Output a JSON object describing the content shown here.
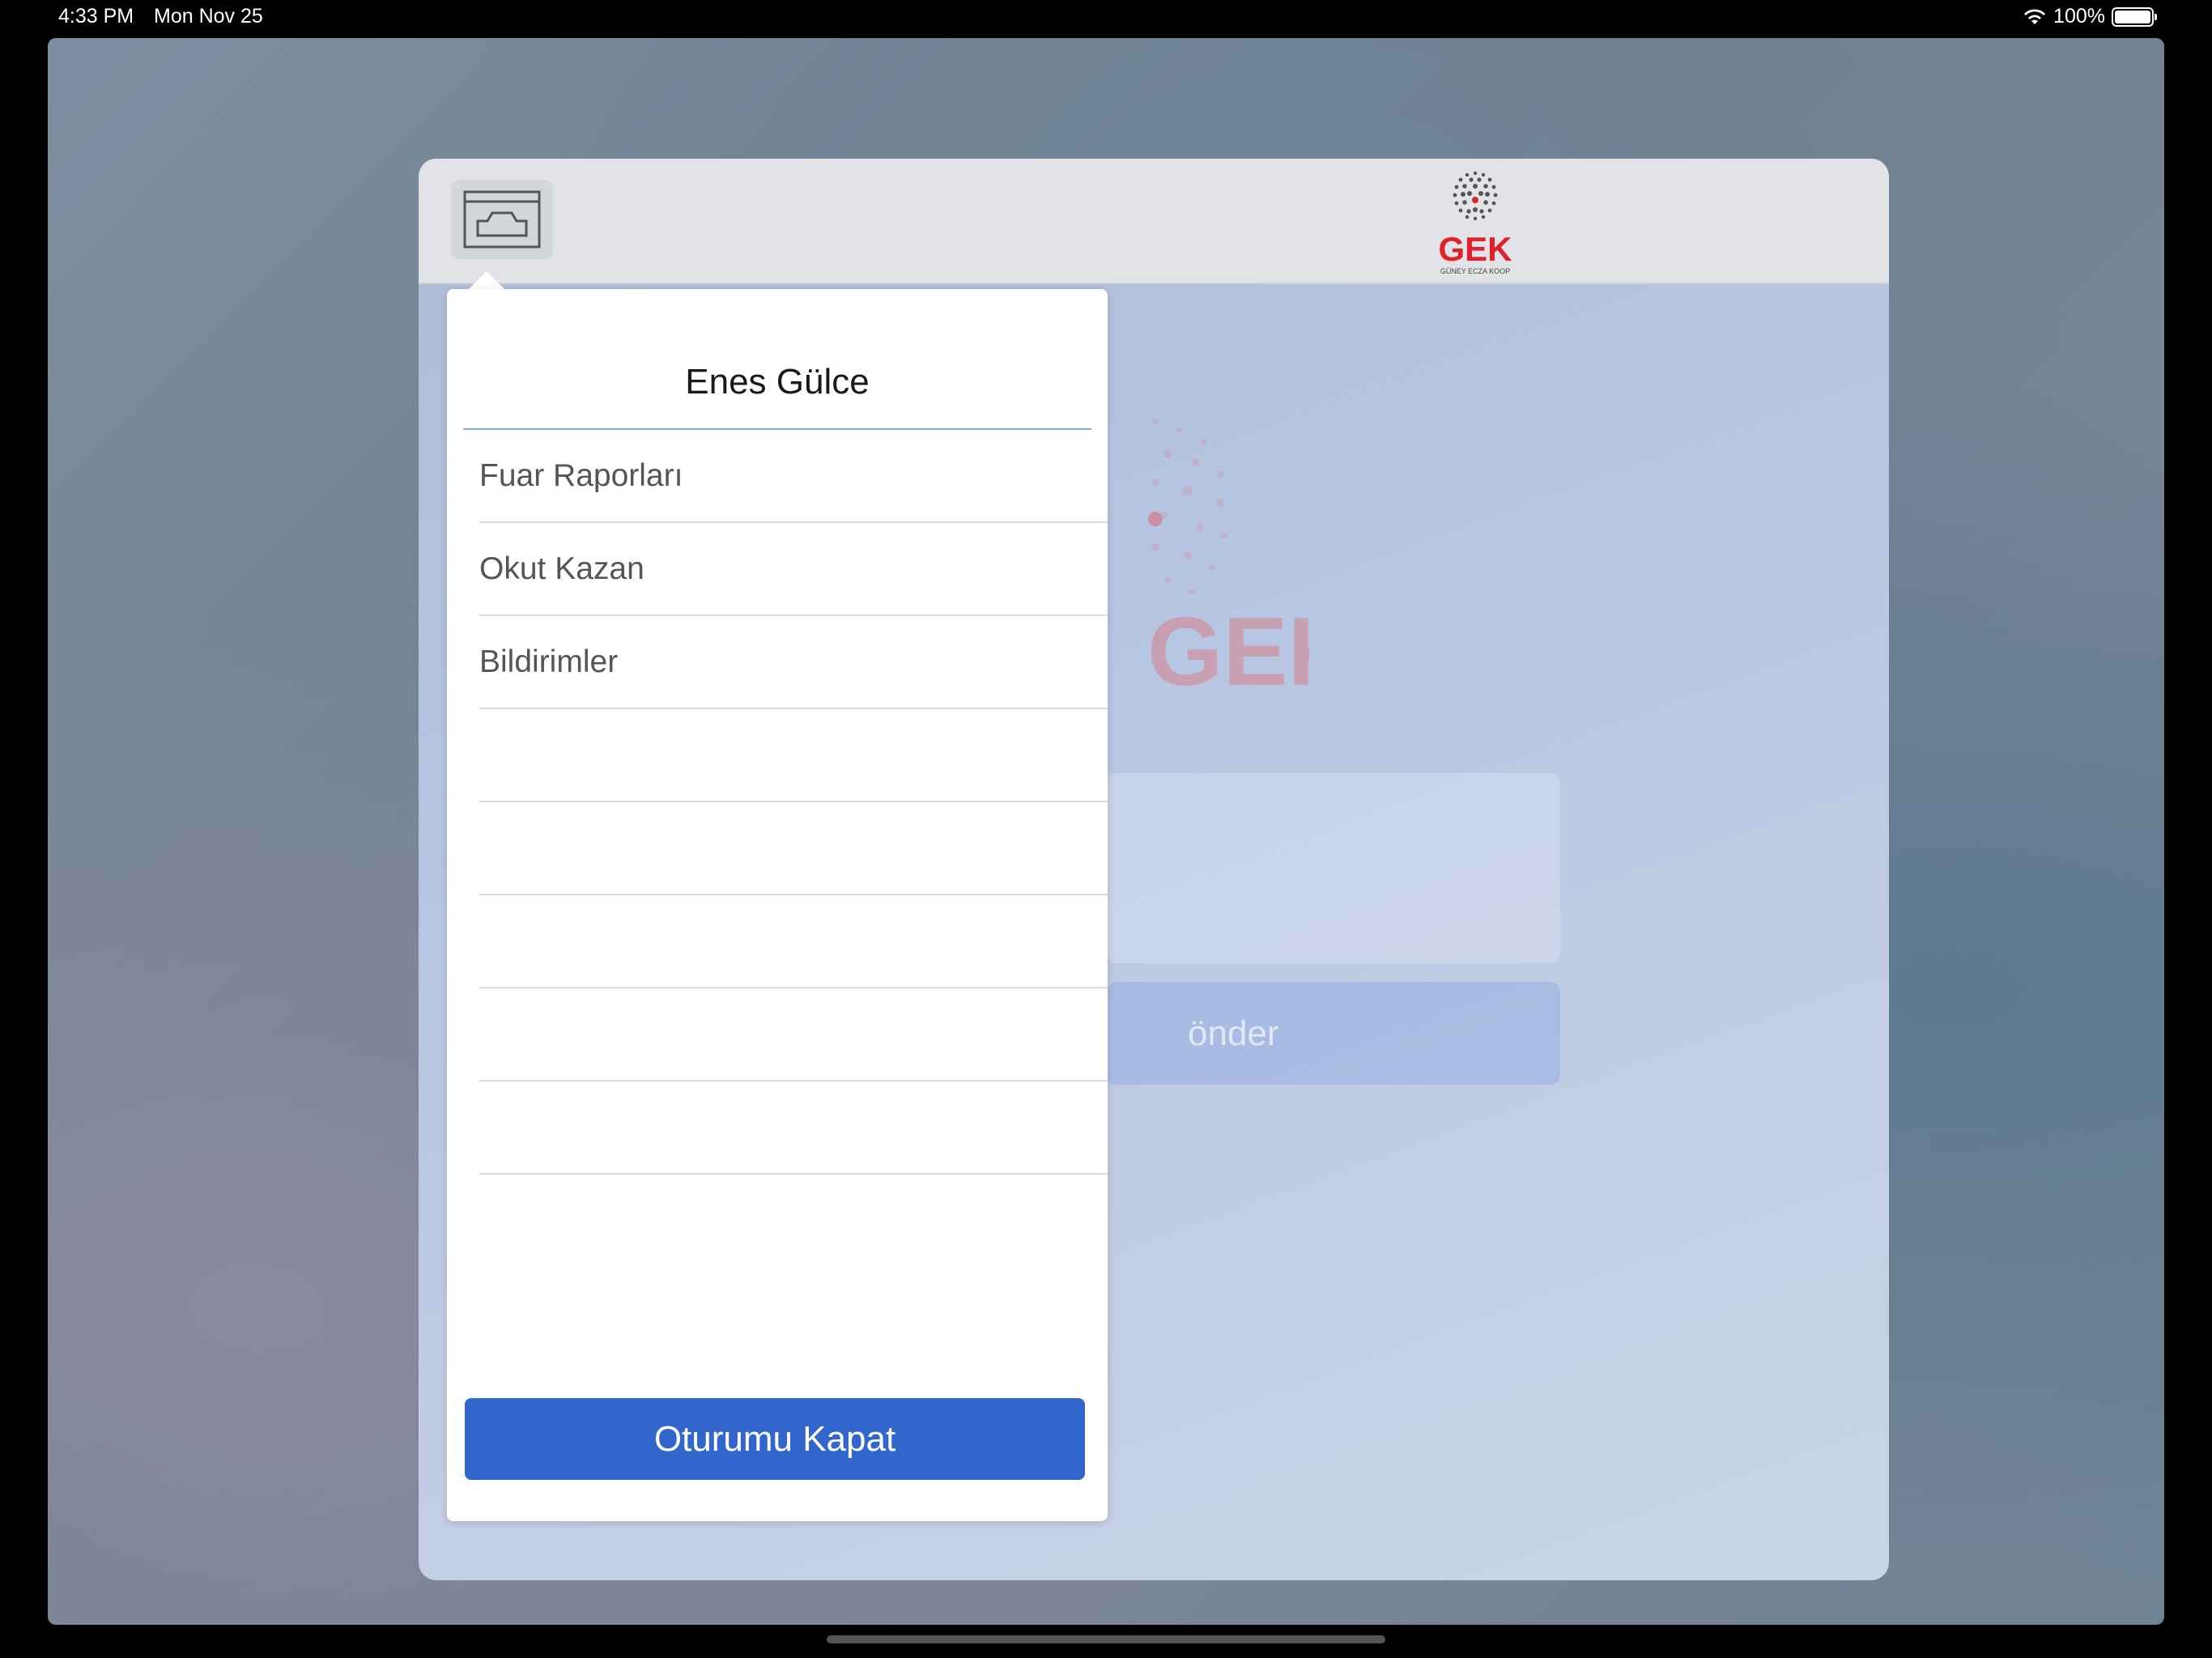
{
  "status_bar": {
    "time": "4:33 PM",
    "date": "Mon Nov 25",
    "battery_percent": "100%",
    "wifi_icon": "wifi-icon",
    "battery_icon": "battery-icon"
  },
  "header": {
    "menu_icon": "window-menu-icon",
    "logo_text": "GEK",
    "logo_subtext": "GÜNEY ECZA KOOP"
  },
  "background_form": {
    "send_label": "önder"
  },
  "popover": {
    "user_name": "Enes Gülce",
    "menu_items": [
      {
        "label": "Fuar Raporları"
      },
      {
        "label": "Okut Kazan"
      },
      {
        "label": "Bildirimler"
      },
      {
        "label": ""
      },
      {
        "label": ""
      },
      {
        "label": ""
      },
      {
        "label": ""
      },
      {
        "label": ""
      }
    ],
    "logout_label": "Oturumu Kapat"
  },
  "colors": {
    "accent": "#3366cc",
    "logo_red": "#e0202a",
    "divider": "#7fb0d8"
  }
}
